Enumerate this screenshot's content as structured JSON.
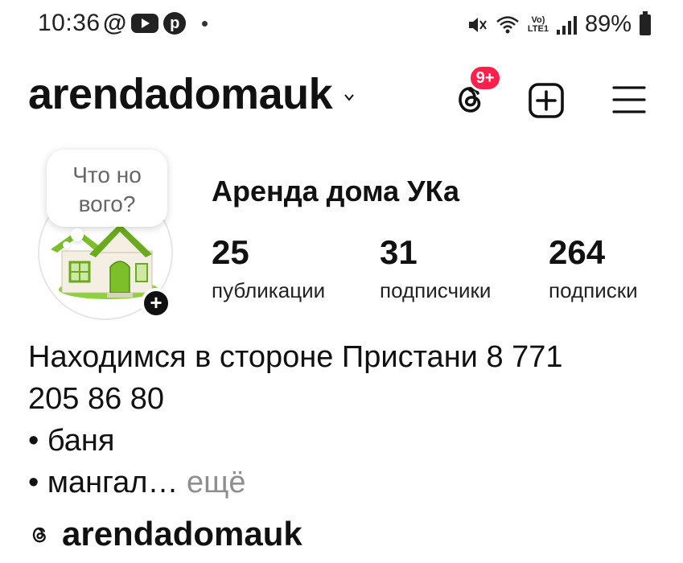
{
  "status_bar": {
    "time": "10:36",
    "at_symbol": "@",
    "battery": "89%",
    "network": "LTE1",
    "icons": [
      "youtube-icon",
      "pinterest-icon",
      "mute-icon",
      "wifi-icon",
      "signal-icon",
      "battery-icon"
    ]
  },
  "header": {
    "username": "arendadomauk",
    "threads_badge": "9+"
  },
  "profile": {
    "note": [
      "Что но",
      "вого?"
    ],
    "display_name": "Аренда дома УКа",
    "stats": [
      {
        "value": "25",
        "label": "публикации"
      },
      {
        "value": "31",
        "label": "подписчики"
      },
      {
        "value": "264",
        "label": "подписки"
      }
    ]
  },
  "bio": {
    "line1": "Находимся в стороне Пристани 8 771",
    "line2": "205 86 80",
    "line3": "• баня",
    "line4": "• мангал…",
    "more": "ещё"
  },
  "threads_link": {
    "text": "arendadomauk"
  },
  "colors": {
    "badge": "#ff1f4b",
    "text": "#111111",
    "muted": "#8e8e8e",
    "house_green": "#7cbf2a"
  }
}
